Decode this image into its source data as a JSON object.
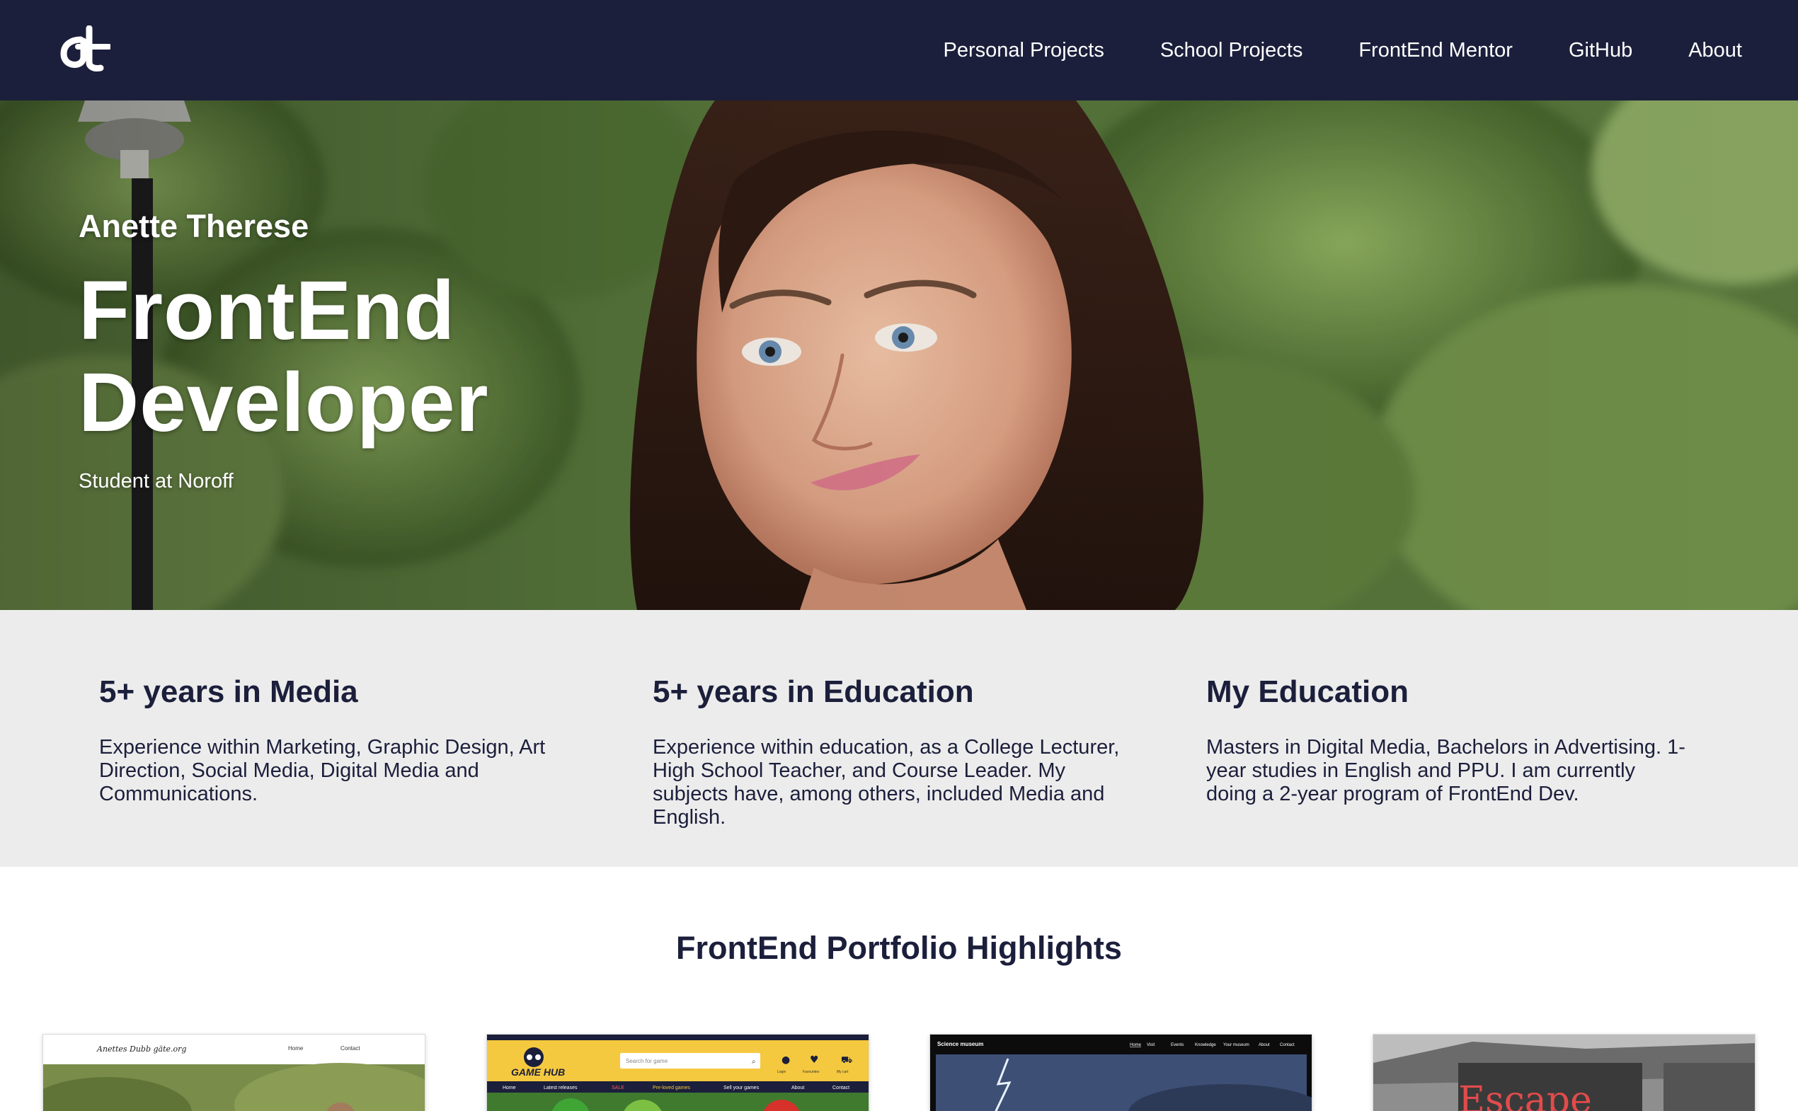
{
  "nav": {
    "logo_text": "at",
    "links": [
      "Personal Projects",
      "School Projects",
      "FrontEnd Mentor",
      "GitHub",
      "About"
    ]
  },
  "hero": {
    "name": "Anette Therese",
    "title_line1": "FrontEnd",
    "title_line2": "Developer",
    "subtitle": "Student at Noroff"
  },
  "info": [
    {
      "heading": "5+ years in Media",
      "text": "Experience within Marketing, Graphic Design, Art Direction, Social Media, Digital Media and Communications."
    },
    {
      "heading": "5+ years in Education",
      "text": "Experience within education, as a College Lecturer, High School Teacher, and Course Leader. My subjects have, among others, included Media and English."
    },
    {
      "heading": "My Education",
      "text": "Masters in Digital Media, Bachelors in Advertising. 1-year studies in English and PPU. I am currently doing a 2-year program of FrontEnd Dev."
    }
  ],
  "highlights": {
    "title": "FrontEnd Portfolio Highlights",
    "cards": [
      {
        "name": "photography-portfolio",
        "header_title": "Anettes Dubb gäte.org",
        "nav_items": [
          "Home",
          "Contact"
        ]
      },
      {
        "name": "game-hub",
        "logo": "GAME HUB",
        "search_placeholder": "Search for game",
        "icons": [
          "Login",
          "Favourites",
          "My cart"
        ],
        "nav_items": [
          "Home",
          "Latest releases",
          "SALE",
          "Pre-loved games",
          "Sell your games",
          "About",
          "Contact"
        ]
      },
      {
        "name": "science-museum",
        "logo": "Science museum",
        "nav_items": [
          "Home",
          "Visit",
          "Events",
          "Knowledge",
          "Your museum",
          "About",
          "Contact"
        ]
      },
      {
        "name": "escape-room",
        "sign_text": "Escape"
      }
    ]
  },
  "colors": {
    "navy": "#1b1f3b",
    "info_bg": "#ececec",
    "white": "#ffffff",
    "gamehub_yellow": "#f5c93f"
  }
}
